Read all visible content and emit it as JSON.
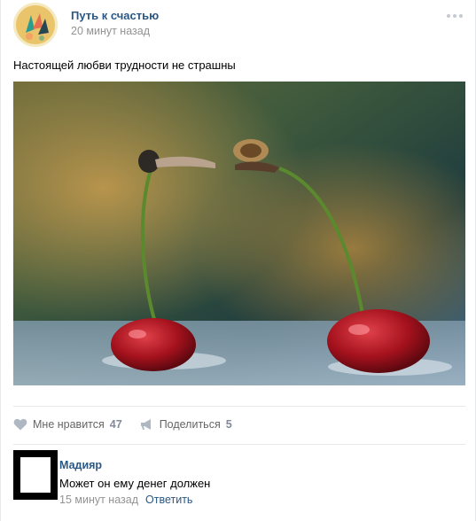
{
  "post": {
    "author": "Путь к счастью",
    "time": "20 минут назад",
    "text": "Настоящей любви трудности не страшны"
  },
  "actions": {
    "like_label": "Мне нравится",
    "like_count": "47",
    "share_label": "Поделиться",
    "share_count": "5"
  },
  "comment": {
    "author": "Мадияр",
    "text": "Может он ему денег должен",
    "time": "15 минут назад",
    "reply_label": "Ответить"
  },
  "colors": {
    "link": "#2a5885",
    "muted": "#939393",
    "action_icon": "#aeb7c2"
  },
  "icons": [
    "more-dots-icon",
    "heart-icon",
    "megaphone-icon"
  ]
}
